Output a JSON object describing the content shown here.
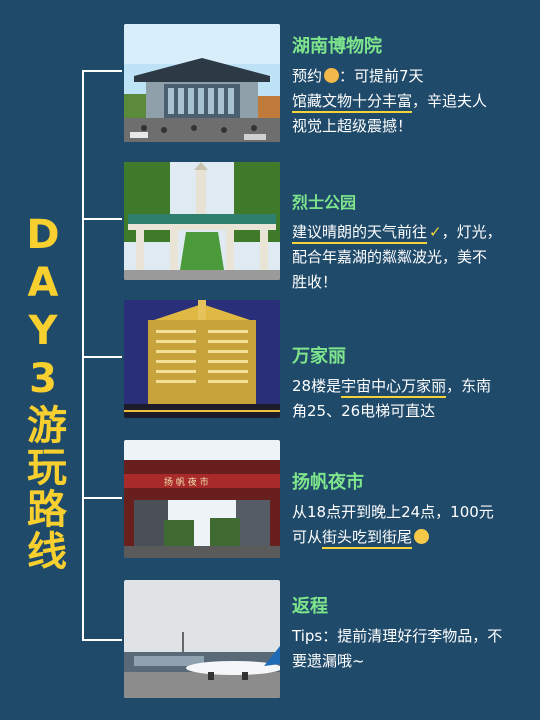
{
  "side_title": "DAY3游玩路线",
  "items": [
    {
      "title": "湖南博物院",
      "line1_pre": "预约",
      "line1_post": "：可提前7天",
      "line2_u": "馆藏文物十分丰富",
      "line2_rest": "，辛追夫人",
      "line3": "视觉上超级震撼！"
    },
    {
      "title": "烈士公园",
      "line1_u": "建议晴朗的天气前往",
      "line1_rest": "，灯光，",
      "line2": "配合年嘉湖的粼粼波光，美不",
      "line3": "胜收！"
    },
    {
      "title": "万家丽",
      "line1_pre": "28楼是",
      "line1_u": "宇宙中心万家丽",
      "line1_rest": "，东南",
      "line2": "角25、26电梯可直达"
    },
    {
      "title": "扬帆夜市",
      "line1": "从18点开到晚上24点，100元",
      "line2_pre": "可从",
      "line2_u": "街头吃到街尾"
    },
    {
      "title": "返程",
      "line1": "Tips：提前清理好行李物品，不",
      "line2": "要遗漏哦~"
    }
  ],
  "sign_text": "扬  帆  夜  市",
  "colors": {
    "background": "#1f4a6a",
    "title_yellow": "#f7cf2f",
    "item_title_green": "#7ee58c",
    "underline_yellow": "#f4d23a"
  }
}
